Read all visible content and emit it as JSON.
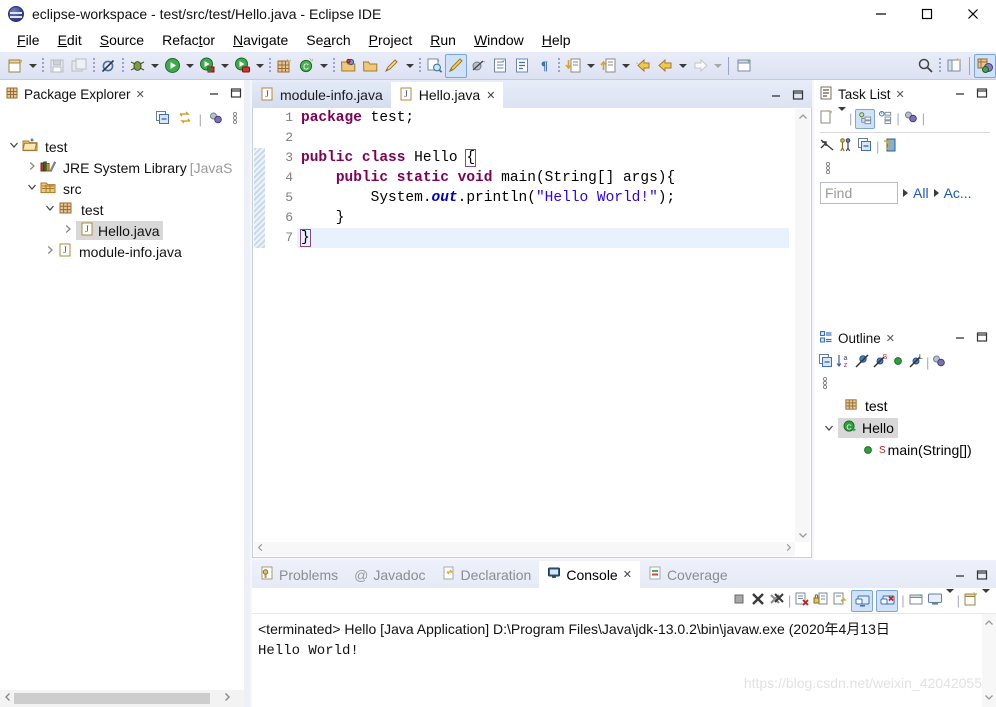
{
  "window": {
    "title": "eclipse-workspace - test/src/test/Hello.java - Eclipse IDE",
    "minimize_label": "—",
    "maximize_label": "□",
    "close_label": "✕"
  },
  "menubar": {
    "items": [
      {
        "label": "File",
        "mnemonic": "F"
      },
      {
        "label": "Edit",
        "mnemonic": "E"
      },
      {
        "label": "Source",
        "mnemonic": "S"
      },
      {
        "label": "Refactor",
        "mnemonic": "t"
      },
      {
        "label": "Navigate",
        "mnemonic": "N"
      },
      {
        "label": "Search",
        "mnemonic": "a"
      },
      {
        "label": "Project",
        "mnemonic": "P"
      },
      {
        "label": "Run",
        "mnemonic": "R"
      },
      {
        "label": "Window",
        "mnemonic": "W"
      },
      {
        "label": "Help",
        "mnemonic": "H"
      }
    ]
  },
  "toolbar": {
    "items": [
      {
        "name": "new-wizard-icon",
        "color": "#f3d58a"
      },
      {
        "name": "new-wizard-dropdown-icon",
        "color": ""
      },
      {
        "name": "save-icon",
        "color": "#c9cfd8"
      },
      {
        "name": "save-all-icon",
        "color": "#c9cfd8"
      },
      {
        "name": "toggle-breadcrumb-icon",
        "color": "#6f86a8"
      },
      {
        "name": "debug-icon",
        "color": "#5f7f3a"
      },
      {
        "name": "debug-dropdown-icon",
        "color": ""
      },
      {
        "name": "run-icon",
        "color": "#2f9e3f"
      },
      {
        "name": "run-dropdown-icon",
        "color": ""
      },
      {
        "name": "run-external-tools-icon",
        "color": "#2f9e3f"
      },
      {
        "name": "run-external-dropdown-icon",
        "color": ""
      },
      {
        "name": "coverage-icon",
        "color": "#d04a3a"
      },
      {
        "name": "coverage-dropdown-icon",
        "color": ""
      },
      {
        "name": "new-java-package-icon",
        "color": "#cf9a5a"
      },
      {
        "name": "new-java-class-icon",
        "color": "#2f9e3f"
      },
      {
        "name": "new-class-dropdown-icon",
        "color": ""
      },
      {
        "name": "open-type-icon",
        "color": "#e8b55d"
      },
      {
        "name": "open-task-icon",
        "color": "#e8b55d"
      },
      {
        "name": "quick-fix-icon",
        "color": "#e0a03a"
      },
      {
        "name": "quick-fix-dropdown-icon",
        "color": ""
      },
      {
        "name": "search-reference-icon",
        "color": "#3c7fbf"
      },
      {
        "name": "toggle-mark-occurrences-icon",
        "color": "#e8c45a"
      },
      {
        "name": "skip-breakpoints-icon",
        "color": "#8a8a8a"
      },
      {
        "name": "open-task-list-icon",
        "color": "#5f7fa8"
      },
      {
        "name": "show-whitespace-icon",
        "color": "#5f7fa8"
      },
      {
        "name": "pilcrow-icon",
        "color": "#3c6fbf"
      },
      {
        "name": "next-annotation-icon",
        "color": "#e0a03a"
      },
      {
        "name": "next-annotation-dropdown-icon",
        "color": ""
      },
      {
        "name": "previous-annotation-icon",
        "color": "#e0a03a"
      },
      {
        "name": "previous-annotation-dropdown-icon",
        "color": ""
      },
      {
        "name": "back-history-icon",
        "color": "#e8b55d"
      },
      {
        "name": "back-icon",
        "color": "#e8b55d"
      },
      {
        "name": "back-dropdown-icon",
        "color": ""
      },
      {
        "name": "forward-icon",
        "color": "#d9d9d9"
      },
      {
        "name": "forward-dropdown-icon",
        "color": ""
      },
      {
        "name": "pin-editor-icon",
        "color": "#2f9e3f"
      },
      {
        "name": "search-icon",
        "color": "#444444"
      },
      {
        "name": "open-perspective-icon",
        "color": "#e8b55d"
      },
      {
        "name": "java-perspective-icon",
        "color": "#6f5fa8"
      }
    ]
  },
  "package_explorer": {
    "tab_title": "Package Explorer",
    "close_label": "✕",
    "minimize_label": "—",
    "maximize_label": "□",
    "tools": [
      {
        "name": "collapse-all-icon"
      },
      {
        "name": "link-with-editor-icon"
      },
      {
        "name": "view-menu-icon"
      },
      {
        "name": "view-options-icon"
      }
    ],
    "tree": [
      {
        "label": "test",
        "icon": "java-project-icon",
        "indent": 0,
        "arrow": "down",
        "selected": false,
        "suffix": ""
      },
      {
        "label": "JRE System Library ",
        "icon": "library-icon",
        "indent": 1,
        "arrow": "right",
        "selected": false,
        "suffix": "[JavaS"
      },
      {
        "label": "src",
        "icon": "source-folder-icon",
        "indent": 1,
        "arrow": "down",
        "selected": false,
        "suffix": ""
      },
      {
        "label": "test",
        "icon": "package-icon",
        "indent": 2,
        "arrow": "down",
        "selected": false,
        "suffix": ""
      },
      {
        "label": "Hello.java",
        "icon": "java-file-icon",
        "indent": 3,
        "arrow": "right",
        "selected": true,
        "suffix": ""
      },
      {
        "label": "module-info.java",
        "icon": "java-file-icon",
        "indent": 2,
        "arrow": "right",
        "selected": false,
        "suffix": ""
      }
    ]
  },
  "editor": {
    "tabs": [
      {
        "label": "module-info.java",
        "active": false,
        "icon": "java-file-icon",
        "closeable": false
      },
      {
        "label": "Hello.java",
        "active": true,
        "icon": "java-file-icon",
        "closeable": true
      }
    ],
    "close_label": "✕",
    "minimize_label": "—",
    "maximize_label": "□",
    "line_numbers": [
      "1",
      "2",
      "3",
      "4",
      "5",
      "6",
      "7"
    ],
    "code_lines": [
      {
        "n": "1",
        "tokens": [
          {
            "t": "package",
            "c": "kw"
          },
          {
            "t": " test;",
            "c": ""
          }
        ],
        "current": false,
        "fold": false
      },
      {
        "n": "2",
        "tokens": [],
        "current": false,
        "fold": false
      },
      {
        "n": "3",
        "tokens": [
          {
            "t": "public class",
            "c": "kw"
          },
          {
            "t": " Hello {",
            "c": ""
          }
        ],
        "current": false,
        "fold": false
      },
      {
        "n": "4",
        "tokens": [
          {
            "t": "    ",
            "c": ""
          },
          {
            "t": "public static void",
            "c": "kw"
          },
          {
            "t": " main(String[] args){",
            "c": ""
          }
        ],
        "current": false,
        "fold": true
      },
      {
        "n": "5",
        "tokens": [
          {
            "t": "        System.",
            "c": ""
          },
          {
            "t": "out",
            "c": "fld"
          },
          {
            "t": ".println(",
            "c": ""
          },
          {
            "t": "\"Hello World!\"",
            "c": "str"
          },
          {
            "t": ");",
            "c": ""
          }
        ],
        "current": false,
        "fold": false
      },
      {
        "n": "6",
        "tokens": [
          {
            "t": "    }",
            "c": ""
          }
        ],
        "current": false,
        "fold": false
      },
      {
        "n": "7",
        "tokens": [
          {
            "t": "}",
            "c": ""
          }
        ],
        "current": true,
        "fold": false
      }
    ]
  },
  "task_list": {
    "tab_title": "Task List",
    "close_label": "✕",
    "minimize_label": "—",
    "maximize_label": "□",
    "tools_row1": [
      {
        "name": "new-task-icon"
      },
      {
        "name": "new-task-dropdown-icon"
      },
      {
        "name": "categorized-presentation-icon"
      },
      {
        "name": "scheduled-presentation-icon"
      },
      {
        "name": "focus-on-workweek-icon"
      }
    ],
    "tools_row2": [
      {
        "name": "synchronize-changed-icon"
      },
      {
        "name": "show-task-hierarchy-icon"
      },
      {
        "name": "collapse-all-icon"
      },
      {
        "name": "restore-tasks-icon"
      }
    ],
    "view_menu": "view-options-icon",
    "find_placeholder": "Find",
    "filters": [
      {
        "label": "All"
      },
      {
        "label": "Ac..."
      }
    ]
  },
  "outline": {
    "tab_title": "Outline",
    "close_label": "✕",
    "minimize_label": "—",
    "maximize_label": "□",
    "tools": [
      {
        "name": "collapse-all-icon"
      },
      {
        "name": "sort-alphabetically-icon"
      },
      {
        "name": "hide-fields-icon"
      },
      {
        "name": "hide-static-members-icon"
      },
      {
        "name": "hide-non-public-icon"
      },
      {
        "name": "hide-local-types-icon"
      },
      {
        "name": "view-menu-icon"
      }
    ],
    "view_options": "view-options-icon",
    "items": [
      {
        "label": "test",
        "icon": "package-icon",
        "indent": 1,
        "arrow": "",
        "selected": false,
        "badge": ""
      },
      {
        "label": "Hello",
        "icon": "java-class-icon",
        "indent": 0,
        "arrow": "down",
        "selected": true,
        "badge": ""
      },
      {
        "label": "main(String[])",
        "icon": "public-method-icon",
        "indent": 2,
        "arrow": "",
        "selected": false,
        "badge": "S"
      }
    ],
    "hscroll": {
      "left_arrow": "‹",
      "right_arrow": "›"
    }
  },
  "console": {
    "tabs": [
      {
        "label": "Problems",
        "icon": "problems-icon",
        "active": false,
        "closeable": false
      },
      {
        "label": "Javadoc",
        "icon": "javadoc-icon",
        "active": false,
        "closeable": false
      },
      {
        "label": "Declaration",
        "icon": "declaration-icon",
        "active": false,
        "closeable": false
      },
      {
        "label": "Console",
        "icon": "console-icon",
        "active": true,
        "closeable": true
      },
      {
        "label": "Coverage",
        "icon": "coverage-icon",
        "active": false,
        "closeable": false
      }
    ],
    "close_label": "✕",
    "minimize_label": "—",
    "maximize_label": "□",
    "toolbar": [
      {
        "name": "terminate-icon"
      },
      {
        "name": "remove-launch-icon"
      },
      {
        "name": "remove-all-terminated-icon"
      },
      {
        "name": "clear-console-icon"
      },
      {
        "name": "scroll-lock-icon"
      },
      {
        "name": "word-wrap-icon"
      },
      {
        "name": "show-console-on-output-icon"
      },
      {
        "name": "show-console-on-error-icon"
      },
      {
        "name": "pin-console-icon"
      },
      {
        "name": "display-selected-console-icon"
      },
      {
        "name": "display-console-dropdown-icon"
      },
      {
        "name": "open-console-icon"
      },
      {
        "name": "open-console-dropdown-icon"
      }
    ],
    "output": [
      "<terminated> Hello [Java Application] D:\\Program Files\\Java\\jdk-13.0.2\\bin\\javaw.exe  (2020年4月13日",
      "Hello World!"
    ]
  },
  "watermark": {
    "text": "https://blog.csdn.net/weixin_42042055"
  },
  "colors": {
    "keyword": "#7f0055",
    "string": "#2a00ff",
    "field": "#0000c0",
    "selection": "#d8d8d8",
    "current_line": "#e8f2fd",
    "toolbar_bg": "#e4e9f6",
    "link": "#1859bf"
  }
}
